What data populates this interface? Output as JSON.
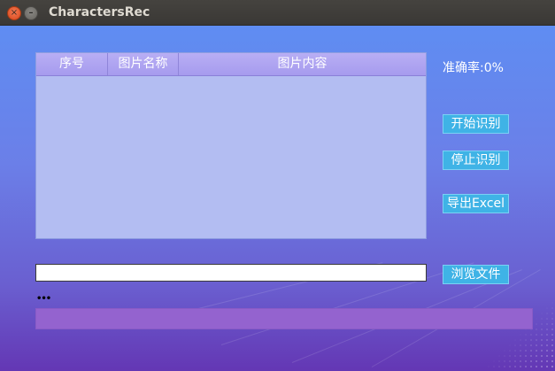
{
  "window": {
    "title": "CharactersRec",
    "close_symbol": "×",
    "minimize_symbol": "–"
  },
  "table": {
    "headers": [
      "序号",
      "图片名称",
      "图片内容"
    ],
    "rows": []
  },
  "accuracy": {
    "label": "准确率:0%"
  },
  "buttons": {
    "start": "开始识别",
    "stop": "停止识别",
    "export": "导出Excel",
    "browse": "浏览文件"
  },
  "path_input": {
    "value": "",
    "placeholder": ""
  },
  "status": {
    "text": "•••"
  },
  "progress": {
    "value": 0
  }
}
